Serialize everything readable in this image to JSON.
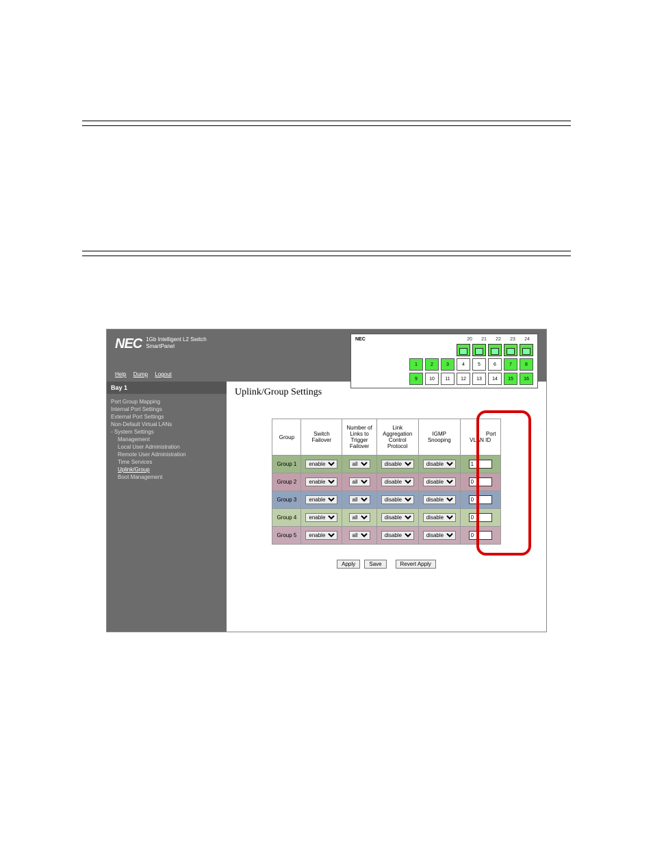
{
  "brand": {
    "logo": "NEC",
    "line1": "1Gb Intelligent L2 Switch",
    "line2": "SmartPanel"
  },
  "menu": {
    "help": "Help",
    "dump": "Dump",
    "logout": "Logout"
  },
  "panel": {
    "nec": "NEC",
    "top": [
      "20",
      "21",
      "22",
      "23",
      "24"
    ],
    "row1": [
      "1",
      "2",
      "3",
      "4",
      "5",
      "6",
      "7",
      "8"
    ],
    "row2": [
      "9",
      "10",
      "11",
      "12",
      "13",
      "14",
      "15",
      "16"
    ]
  },
  "bay": "Bay 1",
  "nav": {
    "a": "Port Group Mapping",
    "b": "Internal Port Settings",
    "c": "External Port Settings",
    "d": "Non-Default Virtual LANs",
    "e": "- System Settings",
    "f": "Management",
    "g": "Local User Administration",
    "h": "Remote User Administration",
    "i": "Time Services",
    "j": "Uplink/Group",
    "k": "Boot Management"
  },
  "title": "Uplink/Group Settings",
  "th": {
    "group": "Group",
    "sf": "Switch\nFailover",
    "ltf": "Number of\nLinks to\nTrigger\nFailover",
    "lacp": "Link\nAggregation\nControl\nProtocol",
    "igmp": "IGMP\nSnooping",
    "pvid": "Port\nVLAN ID"
  },
  "opts": {
    "enable": "enable",
    "disable": "disable",
    "all": "all"
  },
  "rows": [
    {
      "g": "Group 1",
      "sf": "enable",
      "ltf": "all",
      "lacp": "disable",
      "igmp": "disable",
      "pvid": "1"
    },
    {
      "g": "Group 2",
      "sf": "enable",
      "ltf": "all",
      "lacp": "disable",
      "igmp": "disable",
      "pvid": "0"
    },
    {
      "g": "Group 3",
      "sf": "enable",
      "ltf": "all",
      "lacp": "disable",
      "igmp": "disable",
      "pvid": "0"
    },
    {
      "g": "Group 4",
      "sf": "enable",
      "ltf": "all",
      "lacp": "disable",
      "igmp": "disable",
      "pvid": "0"
    },
    {
      "g": "Group 5",
      "sf": "enable",
      "ltf": "all",
      "lacp": "disable",
      "igmp": "disable",
      "pvid": "0"
    }
  ],
  "btn": {
    "apply": "Apply",
    "save": "Save",
    "revert": "Revert Apply"
  }
}
